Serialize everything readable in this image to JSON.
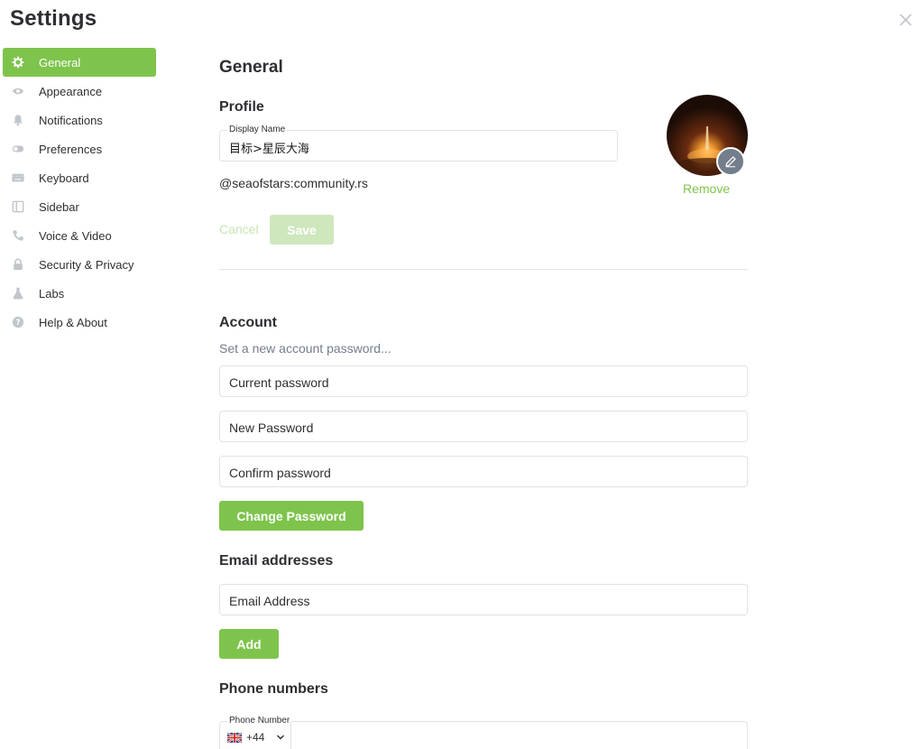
{
  "window": {
    "title": "Settings"
  },
  "sidebar": {
    "items": [
      {
        "label": "General",
        "icon": "gear-icon",
        "active": true
      },
      {
        "label": "Appearance",
        "icon": "eye-icon"
      },
      {
        "label": "Notifications",
        "icon": "bell-icon"
      },
      {
        "label": "Preferences",
        "icon": "toggle-icon"
      },
      {
        "label": "Keyboard",
        "icon": "keyboard-icon"
      },
      {
        "label": "Sidebar",
        "icon": "sidebar-icon"
      },
      {
        "label": "Voice & Video",
        "icon": "phone-icon"
      },
      {
        "label": "Security & Privacy",
        "icon": "lock-icon"
      },
      {
        "label": "Labs",
        "icon": "flask-icon"
      },
      {
        "label": "Help & About",
        "icon": "help-icon"
      }
    ]
  },
  "general": {
    "heading": "General",
    "profile": {
      "heading": "Profile",
      "display_name_label": "Display Name",
      "display_name_value": "目标>星辰大海",
      "user_id": "@seaofstars:community.rs",
      "cancel_label": "Cancel",
      "save_label": "Save",
      "remove_label": "Remove"
    },
    "account": {
      "heading": "Account",
      "hint": "Set a new account password...",
      "current_password_placeholder": "Current password",
      "new_password_placeholder": "New Password",
      "confirm_password_placeholder": "Confirm password",
      "change_password_label": "Change Password"
    },
    "email": {
      "heading": "Email addresses",
      "placeholder": "Email Address",
      "add_label": "Add"
    },
    "phone": {
      "heading": "Phone numbers",
      "field_label": "Phone Number",
      "country_code": "+44"
    }
  },
  "colors": {
    "accent": "#7ec44c",
    "accent_disabled": "#cfe7bd",
    "text": "#2e2f32",
    "muted": "#737d8c"
  }
}
